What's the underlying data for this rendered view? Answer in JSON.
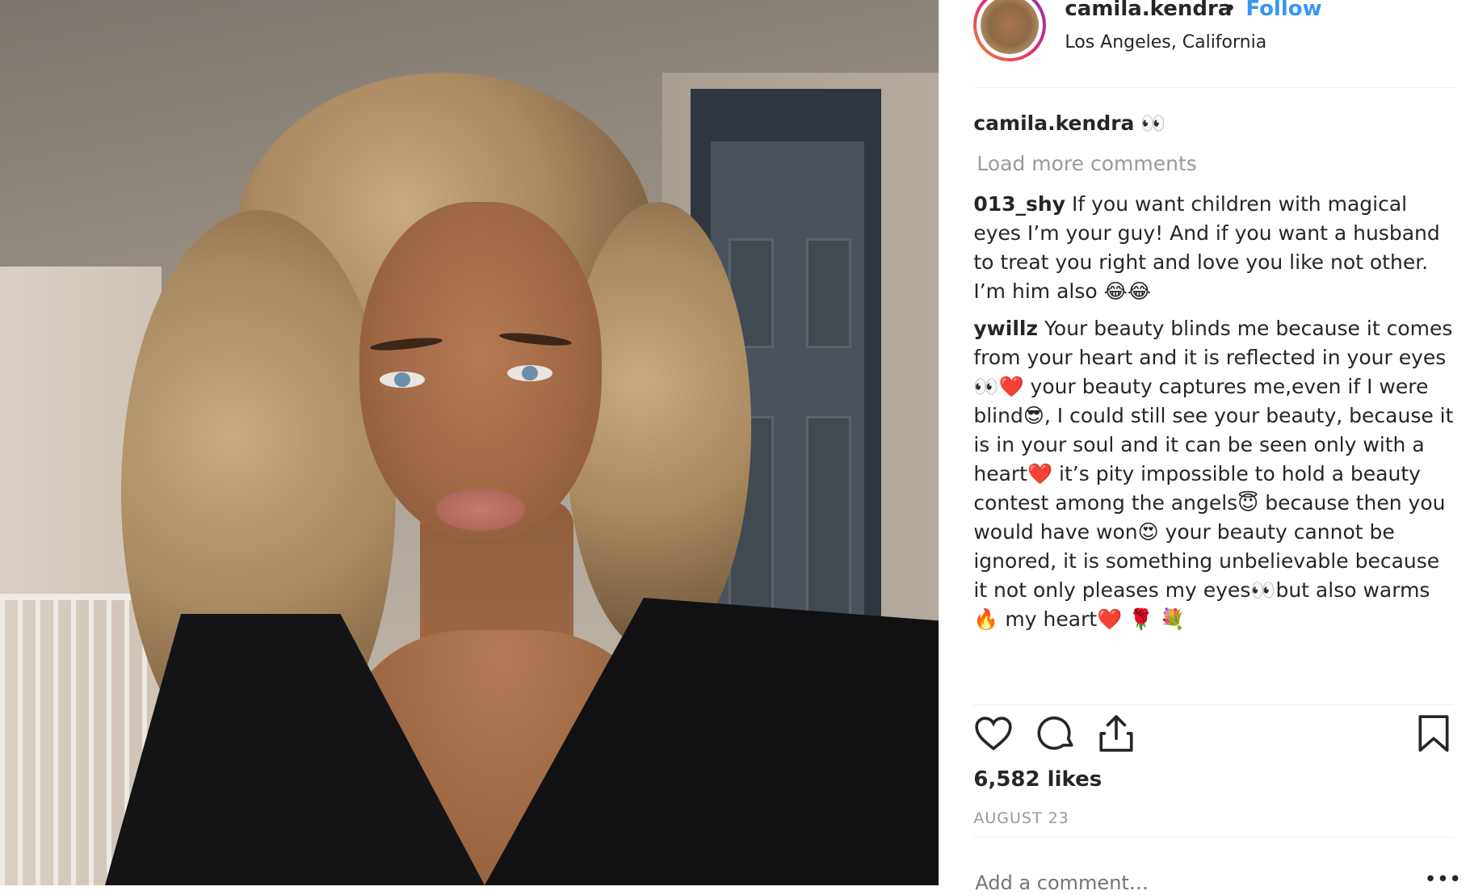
{
  "header": {
    "username": "camila.kendra",
    "separator": "•",
    "follow_label": "Follow",
    "location": "Los Angeles, California"
  },
  "caption": {
    "username": "camila.kendra",
    "text": "👀"
  },
  "load_more_label": "Load more comments",
  "comments": [
    {
      "username": "013_shy",
      "text": "If you want children with magical eyes I’m your guy! And if you want a husband to treat you right and love you like not other. I’m him also 😂😂"
    },
    {
      "username": "ywillz",
      "text": "Your beauty blinds me because it comes from your heart and it is reflected in your eyes👀❤️ your beauty captures me,even if I were blind😎, I could still see your beauty, because it is in your soul and it can be seen only with a heart❤️ it’s pity impossible to hold a beauty contest among the angels😇 because then you would have won😍 your beauty cannot be ignored, it is something unbelievable because it not only pleases my eyes👀but also warms🔥 my heart❤️ 🌹 💐"
    },
    {
      "username": "",
      "text": ""
    }
  ],
  "actions": {
    "like_icon": "heart-icon",
    "comment_icon": "comment-icon",
    "share_icon": "share-icon",
    "save_icon": "bookmark-icon"
  },
  "likes": "6,582 likes",
  "date": "AUGUST 23",
  "add_comment_placeholder": "Add a comment…",
  "more_label": "•••",
  "colors": {
    "follow": "#3897f0",
    "text": "#262626",
    "muted": "#999999",
    "divider": "#efefef"
  }
}
